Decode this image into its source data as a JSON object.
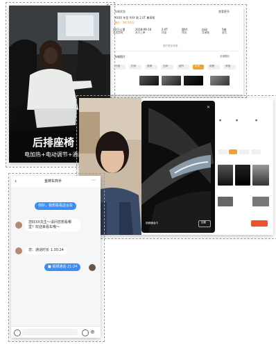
{
  "seat_card": {
    "caption_big": "后排座椅",
    "caption_small": "电加热+电动调节+通风",
    "photo": "woman-sitting-in-rear-seat"
  },
  "dashboard": {
    "header_left": "车辆状态",
    "header_right": "查看更多",
    "info_line1": "XXXX 车型 XXX 款 2.0T 尊享版",
    "info_line2": "售价：XX.XX万",
    "stats": [
      {
        "value": "XX万公里",
        "label": "表显里程"
      },
      {
        "value": "2018-09-10",
        "label": "首次上牌"
      },
      {
        "value": "2.0T",
        "label": "排量"
      },
      {
        "value": "国VI",
        "label": "排放"
      },
      {
        "value": "自动",
        "label": "变速箱"
      },
      {
        "value": "5座",
        "label": "座位"
      }
    ],
    "expand_link": "展开更多参数",
    "section_title": "车辆图片",
    "section_right": "全部图片",
    "tabs": [
      "外观",
      "内饰",
      "座椅",
      "空间",
      "细节",
      "灯光",
      "轮毂",
      "其他"
    ],
    "active_tab": 5
  },
  "chat": {
    "title": "金牌车商手",
    "messages": [
      {
        "side": "right",
        "text": "你好，我想看看这台车"
      },
      {
        "side": "left",
        "text": "您好XX先生～请问您想看哪里？欢迎来看车哦～"
      },
      {
        "side": "left",
        "text": "好的，稍等一下"
      },
      {
        "side": "left",
        "text": "您：通话时长 1:30:24"
      },
      {
        "side": "right",
        "text": "视频通话 21:24"
      }
    ],
    "icons": [
      "back-arrow",
      "more-dots",
      "voice",
      "emoji",
      "plus"
    ]
  },
  "video": {
    "pip_label": "视频通话中",
    "end_label": "挂断",
    "end_btn": "挂断",
    "tab_active_label": "前排"
  }
}
